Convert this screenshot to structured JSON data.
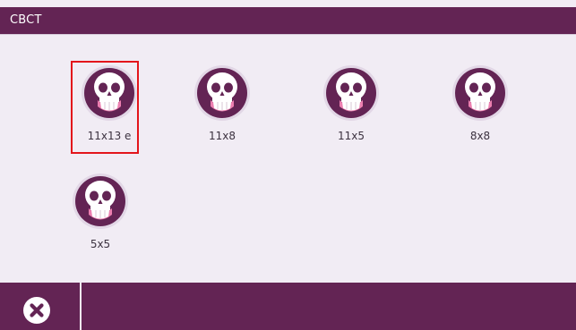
{
  "window": {
    "title": "CBCT"
  },
  "protocols": [
    {
      "label": "11x13 e",
      "icon": "skull-icon",
      "selected": true
    },
    {
      "label": "11x8",
      "icon": "skull-icon",
      "selected": false
    },
    {
      "label": "11x5",
      "icon": "skull-icon",
      "selected": false
    },
    {
      "label": "8x8",
      "icon": "skull-icon",
      "selected": false
    },
    {
      "label": "5x5",
      "icon": "skull-icon",
      "selected": false
    }
  ],
  "footer": {
    "close_icon": "close-icon"
  },
  "colors": {
    "brand": "#632454",
    "background": "#f1ecf4",
    "selection": "#e3151b",
    "jaw_accent": "#ec7fb0"
  }
}
